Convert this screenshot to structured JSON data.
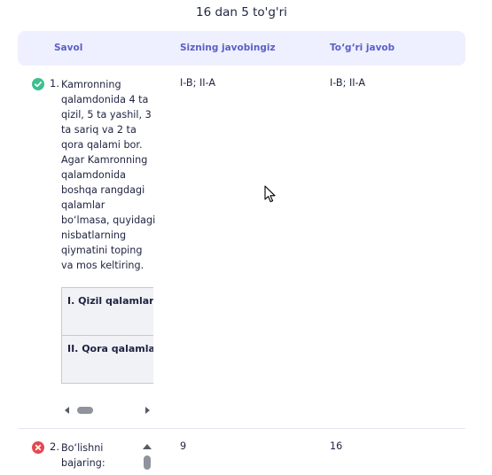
{
  "score_text": "16 dan 5 to'g'ri",
  "table_header": {
    "question": "Savol",
    "your_answer": "Sizning javobingiz",
    "correct_answer": "To‘g‘ri javob"
  },
  "rows": [
    {
      "status": "correct",
      "status_icon": "check-circle-icon",
      "number": "1.",
      "lines": [
        "Kamronning",
        "qalamdonida 4 ta",
        "qizil, 5 ta yashil, 3",
        "ta sariq va 2 ta",
        "qora qalami bor.",
        "Agar Kamronning",
        "qalamdonida",
        "boshqa rangdagi",
        "qalamlar",
        "bo‘lmasa, quyidagi",
        "nisbatlarning",
        "qiymatini toping",
        "va mos keltiring."
      ],
      "inner_table": [
        "I. Qizil qalamlar",
        "II. Qora qalamlar"
      ],
      "your_answer": "I-B; II-A",
      "correct_answer": "I-B; II-A"
    },
    {
      "status": "wrong",
      "status_icon": "x-circle-icon",
      "number": "2.",
      "lines": [
        "Bo‘lishni",
        "bajaring:"
      ],
      "your_answer": "9",
      "correct_answer": "16"
    }
  ],
  "colors": {
    "header_bg": "#eef0ff",
    "header_text": "#5b5fc7",
    "correct": "#3cc08f",
    "wrong": "#e5484d"
  }
}
